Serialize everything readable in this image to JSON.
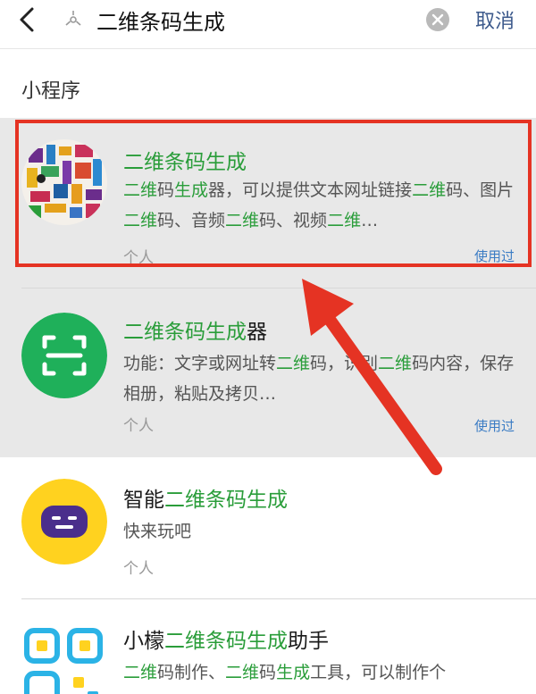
{
  "search": {
    "query": "二维条码生成",
    "cancel_label": "取消"
  },
  "section": {
    "title": "小程序"
  },
  "results": [
    {
      "name_parts": [
        {
          "t": "二维条码生成",
          "h": true
        }
      ],
      "desc_parts": [
        {
          "t": "二维",
          "h": true
        },
        {
          "t": "码",
          "h": false
        },
        {
          "t": "生成",
          "h": true
        },
        {
          "t": "器，可以提供文本网址链接",
          "h": false
        },
        {
          "t": "二维",
          "h": true
        },
        {
          "t": "码、图片",
          "h": false
        },
        {
          "t": "二维",
          "h": true
        },
        {
          "t": "码、音频",
          "h": false
        },
        {
          "t": "二维",
          "h": true
        },
        {
          "t": "码、视频",
          "h": false
        },
        {
          "t": "二维",
          "h": true
        },
        {
          "t": "…",
          "h": false
        }
      ],
      "owner": "个人",
      "used_label": "使用过",
      "highlighted": true
    },
    {
      "name_parts": [
        {
          "t": "二维条码生成",
          "h": true
        },
        {
          "t": "器",
          "h": false
        }
      ],
      "desc_parts": [
        {
          "t": "功能：文字或网址转",
          "h": false
        },
        {
          "t": "二维",
          "h": true
        },
        {
          "t": "码，识别",
          "h": false
        },
        {
          "t": "二维",
          "h": true
        },
        {
          "t": "码内容，保存相册，粘贴及拷贝…",
          "h": false
        }
      ],
      "owner": "个人",
      "used_label": "使用过",
      "highlighted": false
    },
    {
      "name_parts": [
        {
          "t": "智能",
          "h": false
        },
        {
          "t": "二维条码生成",
          "h": true
        }
      ],
      "desc_parts": [
        {
          "t": "快来玩吧",
          "h": false
        }
      ],
      "owner": "个人",
      "used_label": "",
      "highlighted": false
    },
    {
      "name_parts": [
        {
          "t": "小檬",
          "h": false
        },
        {
          "t": "二维条码生成",
          "h": true
        },
        {
          "t": "助手",
          "h": false
        }
      ],
      "desc_parts": [
        {
          "t": "二维",
          "h": true
        },
        {
          "t": "码制作、",
          "h": false
        },
        {
          "t": "二维",
          "h": true
        },
        {
          "t": "码",
          "h": false
        },
        {
          "t": "生成",
          "h": true
        },
        {
          "t": "工具，可以制作个",
          "h": false
        }
      ],
      "owner": "",
      "used_label": "",
      "highlighted": false
    }
  ],
  "colors": {
    "highlight_text": "#2a9d3a",
    "annotation_red": "#e53323",
    "link_blue": "#3b7cc4",
    "cancel_blue": "#3d5a8c"
  },
  "icons": {
    "back": "chevron-left-icon",
    "search": "miniprogram-search-icon",
    "clear": "clear-x-icon",
    "app1": "colorful-qr-art-icon",
    "app2": "green-scan-frame-icon",
    "app3": "purple-bot-face-icon",
    "app4": "cyan-yellow-qr-icon"
  }
}
